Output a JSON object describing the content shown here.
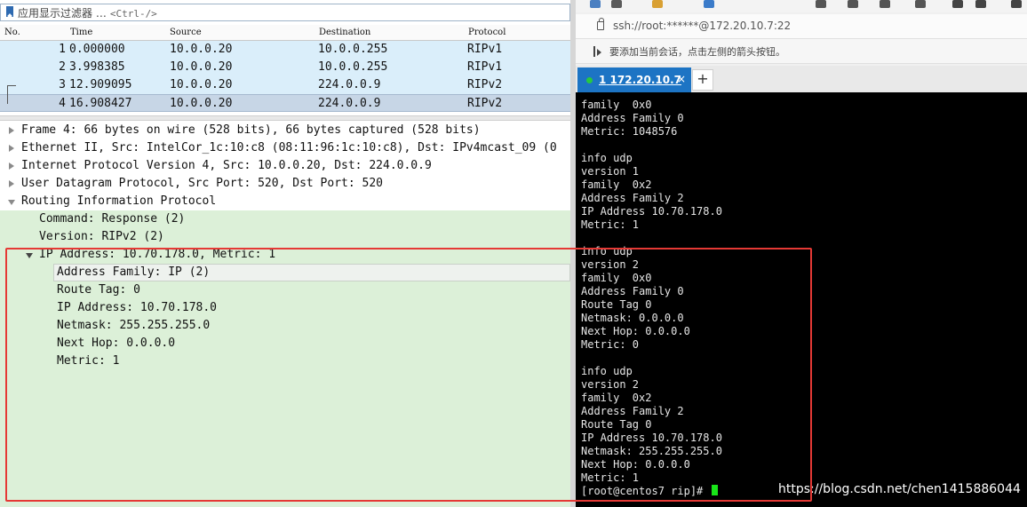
{
  "wireshark": {
    "filter": {
      "label": "应用显示过滤器 …",
      "shortcut": "<Ctrl-/>"
    },
    "columns": [
      "No.",
      "Time",
      "Source",
      "Destination",
      "Protocol"
    ],
    "packets": [
      {
        "no": "1",
        "time": "0.000000",
        "src": "10.0.0.20",
        "dst": "10.0.0.255",
        "proto": "RIPv1"
      },
      {
        "no": "2",
        "time": "3.998385",
        "src": "10.0.0.20",
        "dst": "10.0.0.255",
        "proto": "RIPv1"
      },
      {
        "no": "3",
        "time": "12.909095",
        "src": "10.0.0.20",
        "dst": "224.0.0.9",
        "proto": "RIPv2"
      },
      {
        "no": "4",
        "time": "16.908427",
        "src": "10.0.0.20",
        "dst": "224.0.0.9",
        "proto": "RIPv2"
      }
    ],
    "details": {
      "frame": "Frame 4: 66 bytes on wire (528 bits), 66 bytes captured (528 bits)",
      "ethernet": "Ethernet II, Src: IntelCor_1c:10:c8 (08:11:96:1c:10:c8), Dst: IPv4mcast_09 (0",
      "ip": "Internet Protocol Version 4, Src: 10.0.0.20, Dst: 224.0.0.9",
      "udp": "User Datagram Protocol, Src Port: 520, Dst Port: 520",
      "rip": "Routing Information Protocol",
      "command": "Command: Response (2)",
      "version": "Version: RIPv2 (2)",
      "entry": "IP Address: 10.70.178.0, Metric: 1",
      "family": "Address Family: IP (2)",
      "tag": "Route Tag: 0",
      "ipaddr": "IP Address: 10.70.178.0",
      "netmask": "Netmask: 255.255.255.0",
      "nexthop": "Next Hop: 0.0.0.0",
      "metric": "Metric: 1"
    }
  },
  "terminal_app": {
    "address": "ssh://root:******@172.20.10.7:22",
    "hint": "要添加当前会话，点击左侧的箭头按钮。",
    "tab": {
      "number": "1",
      "label": "172.20.10.7",
      "close": "×"
    },
    "add_tab": "+",
    "lines": [
      "family  0x0",
      "Address Family 0",
      "Metric: 1048576",
      "",
      "info udp",
      "version 1",
      "family  0x2",
      "Address Family 2",
      "IP Address 10.70.178.0",
      "Metric: 1",
      "",
      "info udp",
      "version 2",
      "family  0x0",
      "Address Family 0",
      "Route Tag 0",
      "Netmask: 0.0.0.0",
      "Next Hop: 0.0.0.0",
      "Metric: 0",
      "",
      "info udp",
      "version 2",
      "family  0x2",
      "Address Family 2",
      "Route Tag 0",
      "IP Address 10.70.178.0",
      "Netmask: 255.255.255.0",
      "Next Hop: 0.0.0.0",
      "Metric: 1"
    ],
    "prompt": "[root@centos7 rip]# ",
    "accent_color": "#1d74c4"
  },
  "watermark": "https://blog.csdn.net/chen1415886044",
  "annotation_color": "#e53935"
}
